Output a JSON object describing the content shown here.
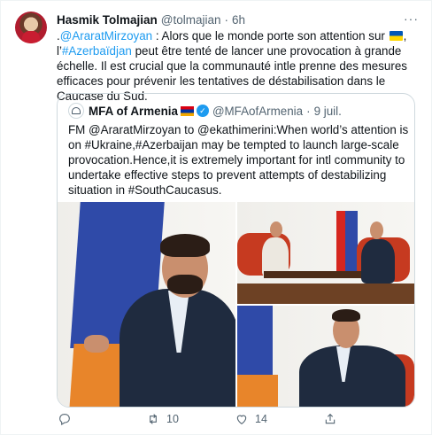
{
  "author": {
    "name": "Hasmik Tolmajian",
    "handle": "@tolmajian",
    "separator": "·",
    "time": "6h",
    "more": "···"
  },
  "tweet": {
    "prefix": ".",
    "mention": "@AraratMirzoyan",
    "part1": " : Alors que le monde porte son attention sur ",
    "part2": ",",
    "part3": "l’",
    "hashtag": "#Azerbaïdjan",
    "part4": " peut être tenté de lancer une provocation à grande échelle. Il est crucial que la communauté intle prenne des mesures efficaces pour prévenir les tentatives de déstabilisation dans le Caucase du Sud."
  },
  "quoted": {
    "name": "MFA of Armenia",
    "verified_glyph": "✓",
    "handle": "@MFAofArmenia",
    "separator": "·",
    "time": "9 juil.",
    "text": "FM @AraratMirzoyan to @ekathimerini:When world’s attention is on #Ukraine,#Azerbaijan may be tempted to launch large-scale provocation.Hence,it is extremely important for intl community to undertake effective steps to prevent attempts of destabilizing situation in #SouthCaucasus."
  },
  "actions": {
    "replies": "",
    "retweets": "10",
    "likes": "14"
  },
  "colors": {
    "link": "#1d9bf0",
    "secondary_text": "#536471",
    "armenian_flag": [
      "#d90012",
      "#0033a0",
      "#f2a800"
    ],
    "ukrainian_flag": [
      "#0057b7",
      "#ffd700"
    ]
  },
  "icons": [
    "more-icon",
    "verified-icon",
    "reply-icon",
    "retweet-icon",
    "like-icon",
    "share-icon"
  ]
}
